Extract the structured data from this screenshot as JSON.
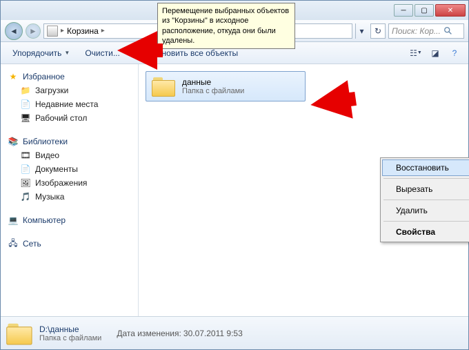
{
  "tooltip": "Перемещение выбранных объектов из \"Корзины\" в исходное расположение, откуда они были удалены.",
  "breadcrumb": {
    "location": "Корзина"
  },
  "search": {
    "placeholder": "Поиск: Кор..."
  },
  "toolbar": {
    "organize": "Упорядочить",
    "empty": "Очисти...",
    "restore_all": "Восстановить все объекты"
  },
  "sidebar": {
    "favorites": {
      "label": "Избранное",
      "items": [
        "Загрузки",
        "Недавние места",
        "Рабочий стол"
      ]
    },
    "libraries": {
      "label": "Библиотеки",
      "items": [
        "Видео",
        "Документы",
        "Изображения",
        "Музыка"
      ]
    },
    "computer": {
      "label": "Компьютер"
    },
    "network": {
      "label": "Сеть"
    }
  },
  "file": {
    "name": "данные",
    "type": "Папка с файлами"
  },
  "context": {
    "restore": "Восстановить",
    "cut": "Вырезать",
    "delete": "Удалить",
    "properties": "Свойства"
  },
  "status": {
    "path": "D:\\данные",
    "type": "Папка с файлами",
    "date_label": "Дата изменения:",
    "date_value": "30.07.2011 9:53"
  }
}
